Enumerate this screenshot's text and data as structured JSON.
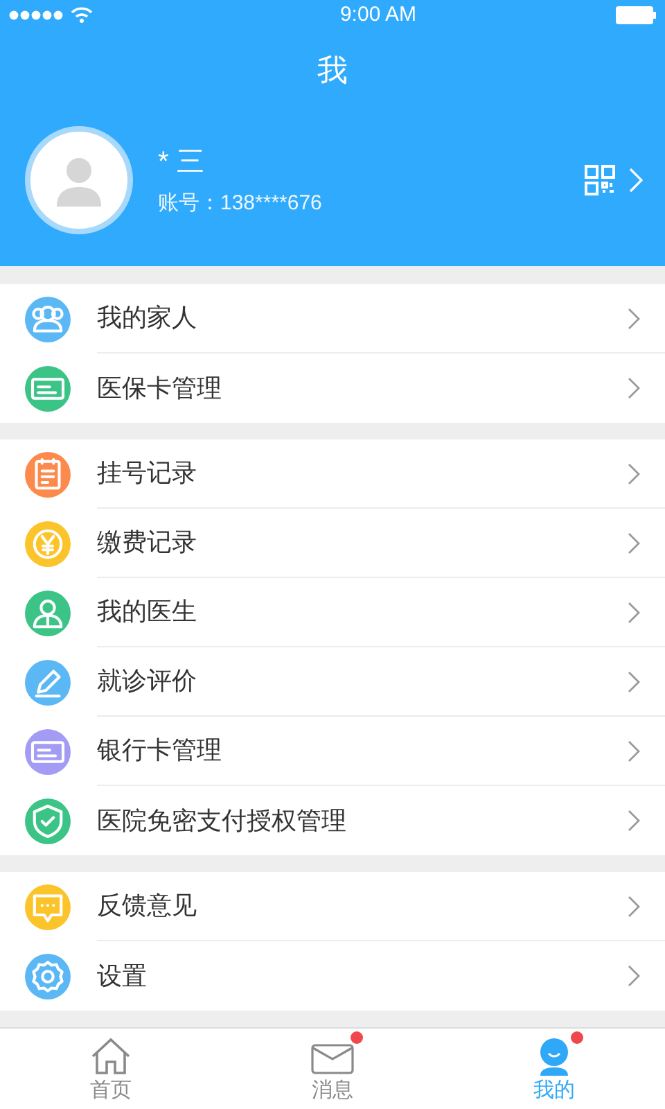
{
  "status_bar": {
    "time": "9:00 AM"
  },
  "header": {
    "title": "我"
  },
  "profile": {
    "name": "* 三",
    "account": "账号：138****676"
  },
  "groups": [
    {
      "items": [
        {
          "label": "我的家人",
          "kind": "family",
          "color": "#5bb8f5"
        },
        {
          "label": "医保卡管理",
          "kind": "card",
          "color": "#3cc486"
        }
      ]
    },
    {
      "items": [
        {
          "label": "挂号记录",
          "kind": "calendar",
          "color": "#fd8a4d"
        },
        {
          "label": "缴费记录",
          "kind": "yen",
          "color": "#fcc42b"
        },
        {
          "label": "我的医生",
          "kind": "doctor",
          "color": "#3cc486"
        },
        {
          "label": "就诊评价",
          "kind": "pen",
          "color": "#5bb8f5"
        },
        {
          "label": "银行卡管理",
          "kind": "card",
          "color": "#a39cf5"
        },
        {
          "label": "医院免密支付授权管理",
          "kind": "shield",
          "color": "#3cc486"
        }
      ]
    },
    {
      "items": [
        {
          "label": "反馈意见",
          "kind": "chat",
          "color": "#fcc42b"
        },
        {
          "label": "设置",
          "kind": "gear",
          "color": "#5bb8f5"
        }
      ]
    }
  ],
  "tab_bar": [
    {
      "label": "首页",
      "kind": "home",
      "selected": false,
      "badge": false
    },
    {
      "label": "消息",
      "kind": "mail",
      "selected": false,
      "badge": true
    },
    {
      "label": "我的",
      "kind": "me",
      "selected": true,
      "badge": true
    }
  ]
}
